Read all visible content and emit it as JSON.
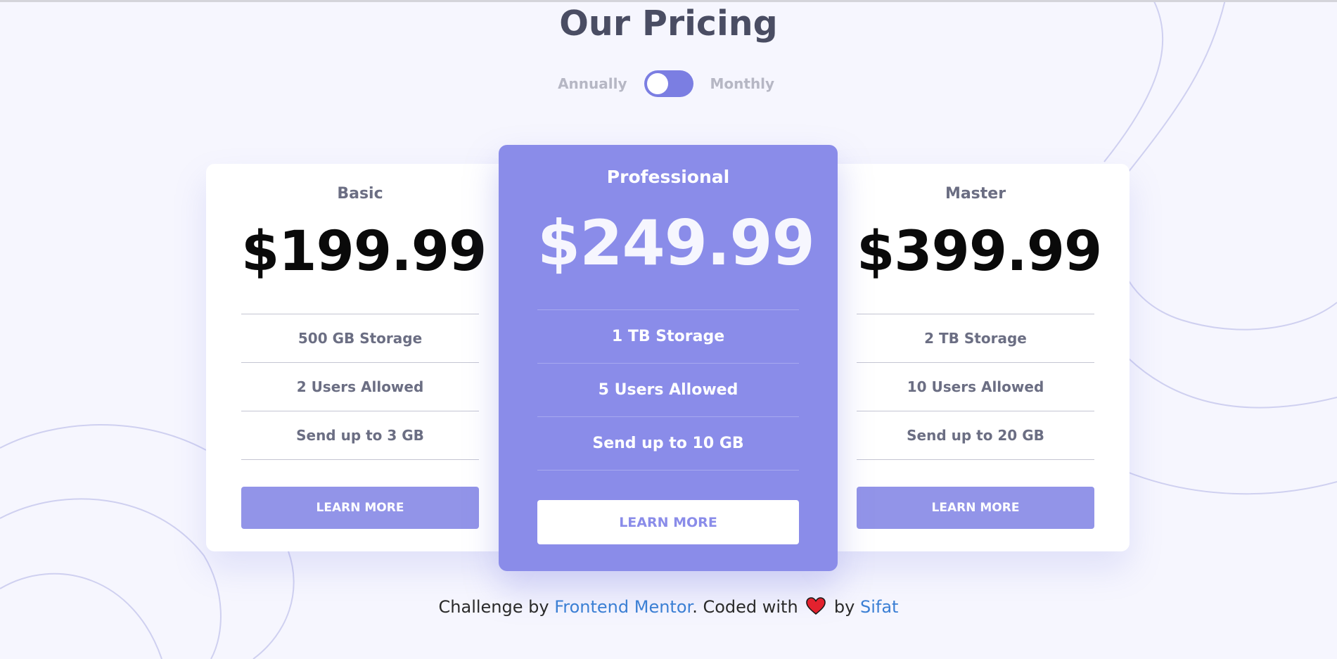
{
  "header": {
    "title": "Our Pricing"
  },
  "billing": {
    "annually_label": "Annually",
    "monthly_label": "Monthly",
    "selected": "Annually"
  },
  "plans": [
    {
      "name": "Basic",
      "price": "$199.99",
      "features": [
        "500 GB Storage",
        "2 Users Allowed",
        "Send up to 3 GB"
      ],
      "button_label": "LEARN MORE"
    },
    {
      "name": "Professional",
      "price": "$249.99",
      "features": [
        "1 TB Storage",
        "5 Users Allowed",
        "Send up to 10 GB"
      ],
      "button_label": "LEARN MORE"
    },
    {
      "name": "Master",
      "price": "$399.99",
      "features": [
        "2 TB Storage",
        "10 Users Allowed",
        "Send up to 20 GB"
      ],
      "button_label": "LEARN MORE"
    }
  ],
  "footer": {
    "prefix": "Challenge by ",
    "challenge_link": "Frontend Mentor",
    "middle": ". Coded with ",
    "by": " by ",
    "author_link": "Sifat"
  },
  "colors": {
    "accent": "#8a8ce9",
    "background": "#f6f6fe",
    "title": "#4a4d63",
    "link": "#3b7fd4",
    "heart": "#e3222e"
  },
  "icons": {
    "heart": "heart-icon"
  }
}
